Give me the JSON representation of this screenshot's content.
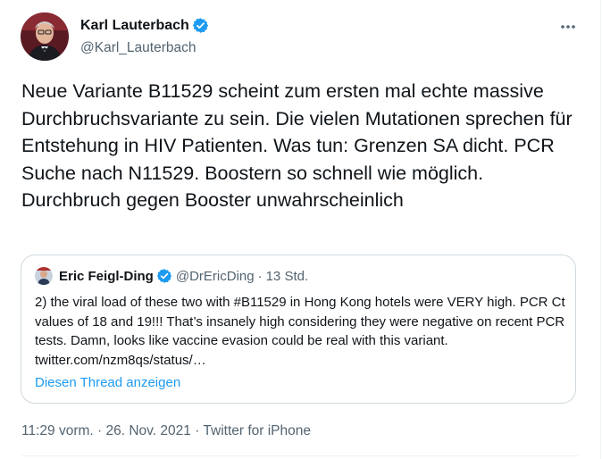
{
  "tweet": {
    "author": {
      "display_name": "Karl Lauterbach",
      "handle": "@Karl_Lauterbach",
      "verified": true,
      "verified_color": "#1d9bf0"
    },
    "text": "Neue Variante B11529 scheint zum ersten mal echte massive Durchbruchsvariante zu sein. Die vielen Mutationen sprechen für Entstehung in HIV Patienten. Was tun: Grenzen SA dicht. PCR Suche nach N11529. Boostern so schnell wie möglich. Durchbruch gegen Booster unwahrscheinlich",
    "more_icon": "more-horizontal-icon",
    "quoted": {
      "display_name": "Eric Feigl-Ding",
      "handle": "@DrEricDing",
      "separator": "·",
      "time_ago": "13 Std.",
      "verified": true,
      "text": "2) the viral load of these two with #B11529 in Hong Kong hotels were VERY high. PCR Ct values of 18 and 19!!! That’s insanely high considering they were negative on recent PCR tests. Damn, looks like vaccine evasion could be real with this variant. twitter.com/nzm8qs/status/…",
      "show_thread_label": "Diesen Thread anzeigen"
    },
    "footer": {
      "time": "11:29 vorm.",
      "sep1": "·",
      "date": "26. Nov. 2021",
      "sep2": "·",
      "source": "Twitter for iPhone"
    }
  },
  "colors": {
    "text_primary": "#0f1419",
    "text_secondary": "#536471",
    "link": "#1d9bf0",
    "border": "#cfd9de"
  }
}
